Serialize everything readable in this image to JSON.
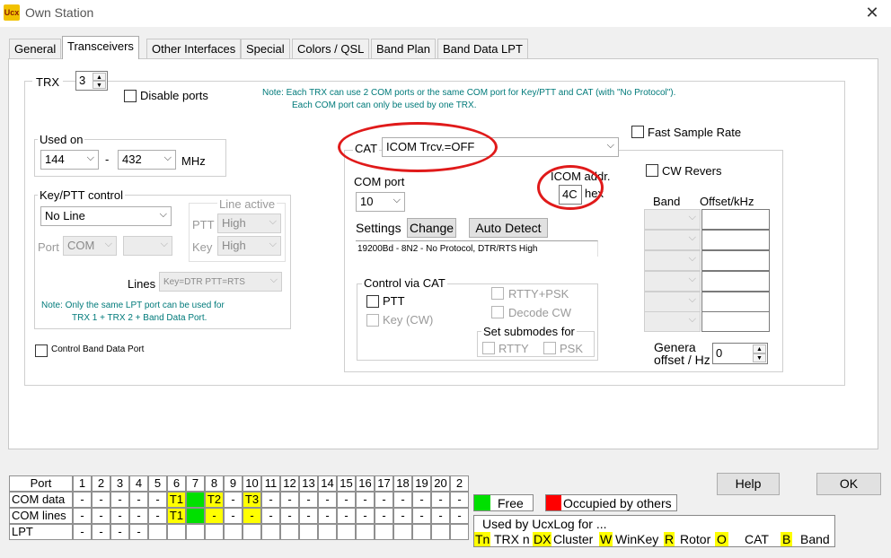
{
  "window": {
    "title": "Own Station",
    "app_icon_text": "Ucx"
  },
  "tabs": [
    "General",
    "Transceivers",
    "Other Interfaces",
    "Special",
    "Colors / QSL",
    "Band Plan",
    "Band Data LPT"
  ],
  "trx": {
    "label": "TRX",
    "value": "3",
    "disable_ports": "Disable ports"
  },
  "note_top": {
    "line1": "Note: Each TRX can use 2 COM ports or the same COM port for Key/PTT and CAT (with \"No Protocol\").",
    "line2": "Each COM port can only be used by one TRX."
  },
  "used_on": {
    "legend": "Used on",
    "from": "144",
    "dash": "-",
    "to": "432",
    "unit": "MHz"
  },
  "keyptt": {
    "legend": "Key/PTT control",
    "mode": "No Line",
    "port_label": "Port",
    "port_value": "COM",
    "line_active": "Line active",
    "ptt_label": "PTT",
    "ptt_value": "High",
    "key_label": "Key",
    "key_value": "High",
    "lines_label": "Lines",
    "lines_value": "Key=DTR PTT=RTS",
    "note1": "Note: Only the same LPT port can be used for",
    "note2": "TRX 1 + TRX 2 + Band Data Port."
  },
  "control_band_data_port": "Control Band Data Port",
  "cat": {
    "label": "CAT",
    "value": "ICOM Trcv.=OFF",
    "com_port_label": "COM port",
    "com_port_value": "10",
    "icom_addr_label": "ICOM addr.",
    "icom_addr_value": "4C",
    "icom_hex": "hex",
    "settings_label": "Settings",
    "change_button": "Change",
    "auto_detect_button": "Auto Detect",
    "settings_value": "19200Bd - 8N2 - No Protocol, DTR/RTS High"
  },
  "control_via_cat": {
    "legend": "Control via CAT",
    "ptt": "PTT",
    "key_cw": "Key (CW)",
    "rtty_psk": "RTTY+PSK",
    "decode_cw": "Decode CW",
    "submodes_legend": "Set submodes for",
    "rtty": "RTTY",
    "psk": "PSK"
  },
  "fast_sample_rate": "Fast Sample Rate",
  "cw_revers": "CW Revers",
  "band_table": {
    "band_header": "Band",
    "offset_header": "Offset/kHz"
  },
  "general_offset": {
    "label1": "Genera",
    "label2": "offset / Hz",
    "value": "0"
  },
  "buttons": {
    "help": "Help",
    "ok": "OK"
  },
  "port_grid": {
    "port_header": "Port",
    "columns": [
      "1",
      "2",
      "3",
      "4",
      "5",
      "6",
      "7",
      "8",
      "9",
      "10",
      "11",
      "12",
      "13",
      "14",
      "15",
      "16",
      "17",
      "18",
      "19",
      "20",
      "2"
    ],
    "rows": [
      {
        "label": "COM data",
        "cells": [
          "-",
          "-",
          "-",
          "-",
          "-",
          "T1",
          "",
          "T2",
          "-",
          "T3",
          "-",
          "-",
          "-",
          "-",
          "-",
          "-",
          "-",
          "-",
          "-",
          "-",
          "-"
        ]
      },
      {
        "label": "COM lines",
        "cells": [
          "-",
          "-",
          "-",
          "-",
          "-",
          "T1",
          "",
          "-",
          "-",
          "-",
          "-",
          "-",
          "-",
          "-",
          "-",
          "-",
          "-",
          "-",
          "-",
          "-",
          "-"
        ]
      },
      {
        "label": "LPT",
        "cells": [
          "-",
          "-",
          "-",
          "-",
          "",
          "",
          "",
          "",
          "",
          "",
          "",
          "",
          "",
          "",
          "",
          "",
          "",
          "",
          "",
          "",
          ""
        ]
      }
    ]
  },
  "legend_box": {
    "free": "Free",
    "occupied": "Occupied by others",
    "used_by": "Used by UcxLog for ...",
    "tn": "Tn",
    "trx_n": "TRX n",
    "dx": "DX",
    "cluster": "Cluster",
    "w": "W",
    "winkey": "WinKey",
    "r": "R",
    "rotor": "Rotor",
    "o": "O",
    "cat": "CAT",
    "b": "B",
    "band": "Band"
  },
  "colors": {
    "free": "#00e000",
    "occupied": "#ff0000",
    "used": "#ffff00",
    "annotation": "#e01a1a"
  }
}
